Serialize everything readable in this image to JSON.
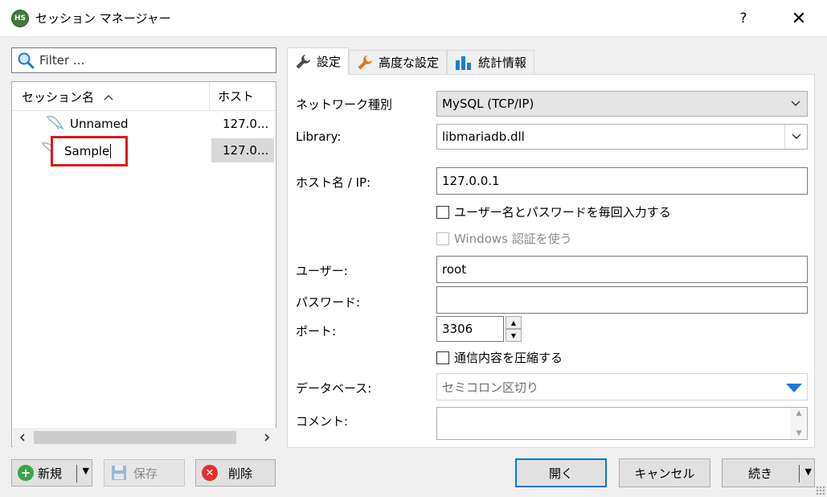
{
  "window": {
    "title": "セッション マネージャー",
    "app_badge": "HS",
    "help": "?",
    "close": "✕"
  },
  "filter": {
    "placeholder": "Filter ..."
  },
  "tree": {
    "col_name": "セッション名",
    "col_host": "ホスト",
    "rows": [
      {
        "name": "Unnamed",
        "host": "127.0..."
      },
      {
        "name": "Sample",
        "host": "127.0..."
      }
    ]
  },
  "left_buttons": {
    "new": "新規",
    "save": "保存",
    "delete": "削除"
  },
  "tabs": [
    {
      "label": "設定"
    },
    {
      "label": "高度な設定"
    },
    {
      "label": "統計情報"
    }
  ],
  "settings": {
    "network_type_label": "ネットワーク種別",
    "network_type_value": "MySQL (TCP/IP)",
    "library_label": "Library:",
    "library_value": "libmariadb.dll",
    "host_label": "ホスト名 / IP:",
    "host_value": "127.0.0.1",
    "prompt_login_label": "ユーザー名とパスワードを毎回入力する",
    "windows_auth_label": "Windows 認証を使う",
    "user_label": "ユーザー:",
    "user_value": "root",
    "password_label": "パスワード:",
    "password_value": "",
    "port_label": "ポート:",
    "port_value": "3306",
    "compress_label": "通信内容を圧縮する",
    "database_label": "データベース:",
    "database_placeholder": "セミコロン区切り",
    "comment_label": "コメント:"
  },
  "bottom_buttons": {
    "open": "開く",
    "cancel": "キャンセル",
    "continue": "続き"
  },
  "colors": {
    "accent": "#0078d7",
    "highlight_red": "#e01818",
    "db_arrow": "#1e7ad6"
  }
}
